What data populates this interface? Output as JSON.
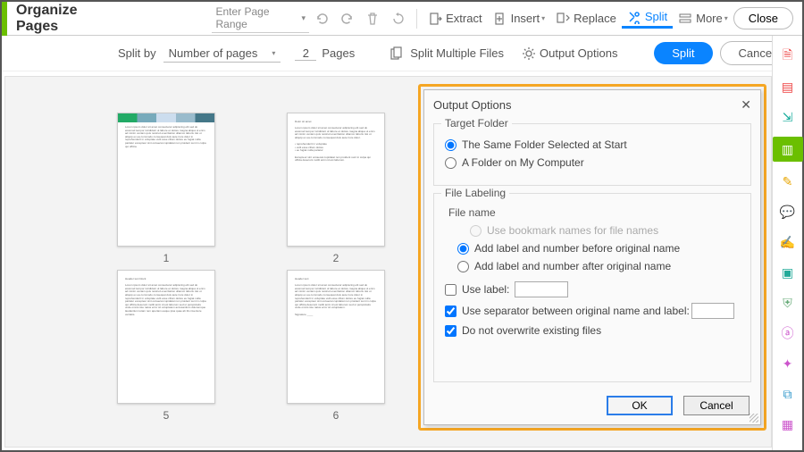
{
  "topbar": {
    "title": "Organize Pages",
    "page_range_placeholder": "Enter Page Range",
    "extract": "Extract",
    "insert": "Insert",
    "replace": "Replace",
    "split": "Split",
    "more": "More",
    "close": "Close"
  },
  "subbar": {
    "split_by": "Split by",
    "mode": "Number of pages",
    "count": "2",
    "pages": "Pages",
    "split_multiple": "Split Multiple Files",
    "output_options": "Output Options",
    "split_btn": "Split",
    "cancel_btn": "Cancel"
  },
  "thumbs": [
    "1",
    "2",
    "5",
    "6"
  ],
  "dialog": {
    "title": "Output Options",
    "target_folder": "Target Folder",
    "tf_same": "The Same Folder Selected at Start",
    "tf_other": "A Folder on My Computer",
    "file_labeling": "File Labeling",
    "file_name": "File name",
    "fn_bookmark": "Use bookmark names for file names",
    "fn_before": "Add label and number before original name",
    "fn_after": "Add label and number after original name",
    "use_label": "Use label:",
    "use_separator": "Use separator between original name and label:",
    "no_overwrite": "Do not overwrite existing files",
    "ok": "OK",
    "cancel": "Cancel"
  },
  "colors": {
    "accent": "#0a84ff",
    "highlight": "#f5a623",
    "green": "#6bbf00"
  }
}
